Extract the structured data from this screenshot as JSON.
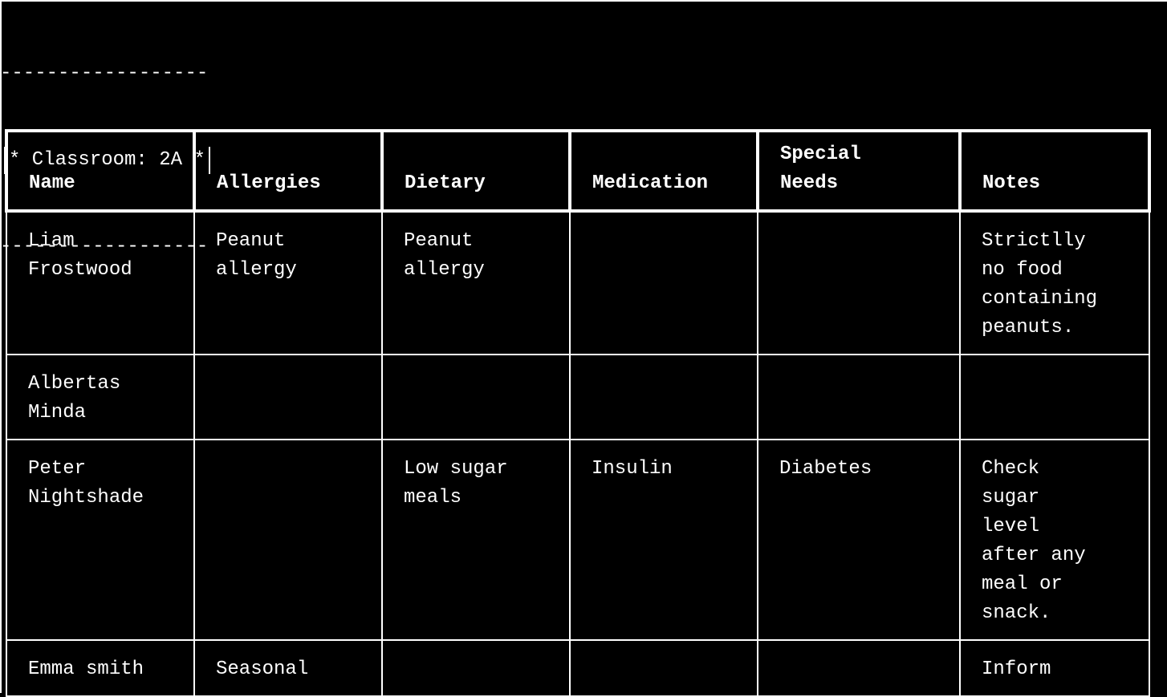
{
  "banner": {
    "rule_top": "------------------",
    "title": "* Classroom: 2A *",
    "rule_bottom": "------------------"
  },
  "table": {
    "headers": [
      "Name",
      "Allergies",
      "Dietary",
      "Medication",
      "Special\nNeeds",
      "Notes"
    ],
    "rows": [
      {
        "name": "Liam\nFrostwood",
        "allergies": "Peanut\nallergy",
        "dietary": "Peanut\nallergy",
        "medication": "",
        "special_needs": "",
        "notes": "Strictlly\nno food\ncontaining\npeanuts."
      },
      {
        "name": "Albertas\nMinda",
        "allergies": "",
        "dietary": "",
        "medication": "",
        "special_needs": "",
        "notes": ""
      },
      {
        "name": "Peter\nNightshade",
        "allergies": "",
        "dietary": "Low sugar\nmeals",
        "medication": "Insulin",
        "special_needs": "Diabetes",
        "notes": "Check\nsugar\nlevel\nafter any\nmeal or\nsnack."
      },
      {
        "name": "Emma smith",
        "allergies": "Seasonal",
        "dietary": "",
        "medication": "",
        "special_needs": "",
        "notes": "Inform"
      }
    ]
  }
}
